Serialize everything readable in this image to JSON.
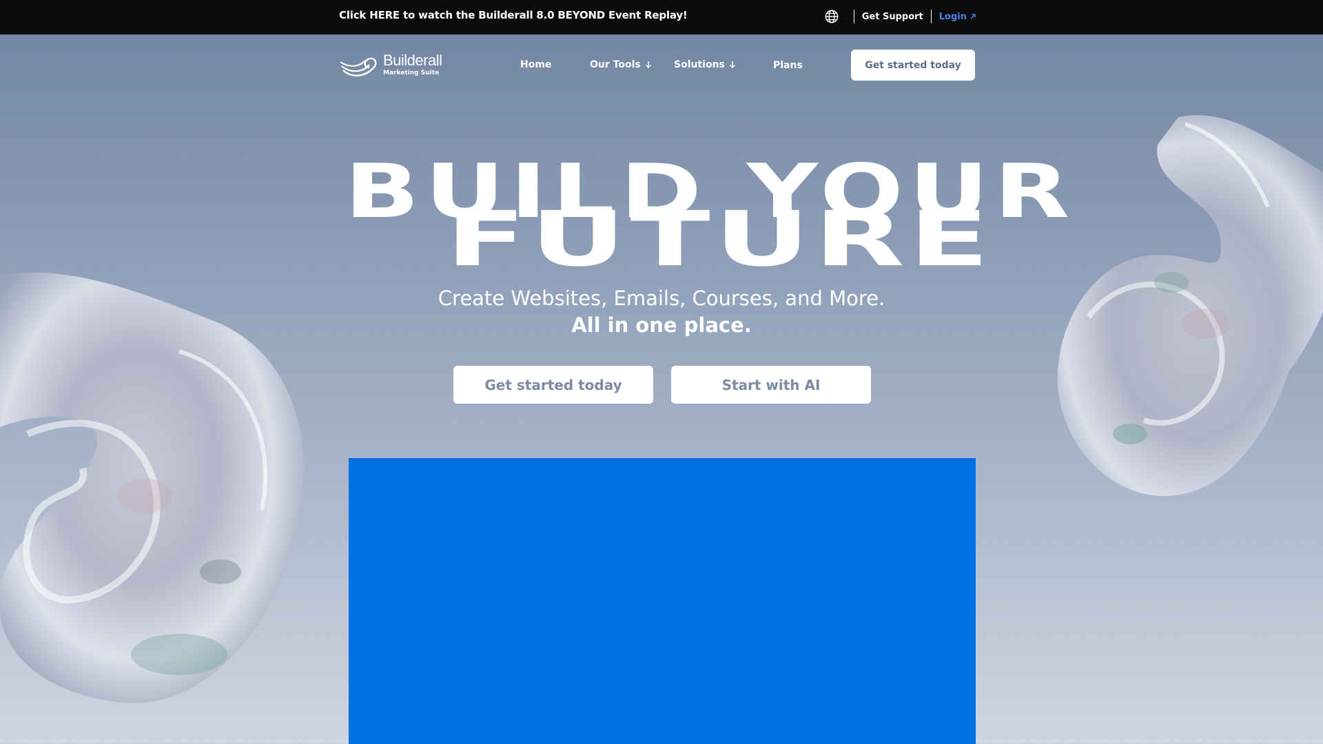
{
  "topbar": {
    "announcement": "Click HERE to watch the Builderall 8.0 BEYOND Event Replay!",
    "globe_icon": "globe-icon",
    "support": "Get Support",
    "login": "Login",
    "login_icon": "arrow-up-right-icon",
    "login_color": "#4a82e8"
  },
  "nav": {
    "logo_name": "Builderall",
    "logo_sub": "Marketing Suite",
    "items": [
      {
        "label": "Home"
      },
      {
        "label": "Our Tools",
        "icon": "arrow-down-icon"
      },
      {
        "label": "Solutions",
        "icon": "arrow-down-icon"
      },
      {
        "label": "Plans"
      }
    ],
    "cta": "Get started today"
  },
  "hero": {
    "line1": "BUILD YOUR",
    "line2": "FUTURE",
    "sub1": "Create Websites, Emails, Courses, and More.",
    "sub2": "All in one place.",
    "btn_primary": "Get started today",
    "btn_secondary": "Start with AI",
    "video_color": "#0071e3"
  }
}
